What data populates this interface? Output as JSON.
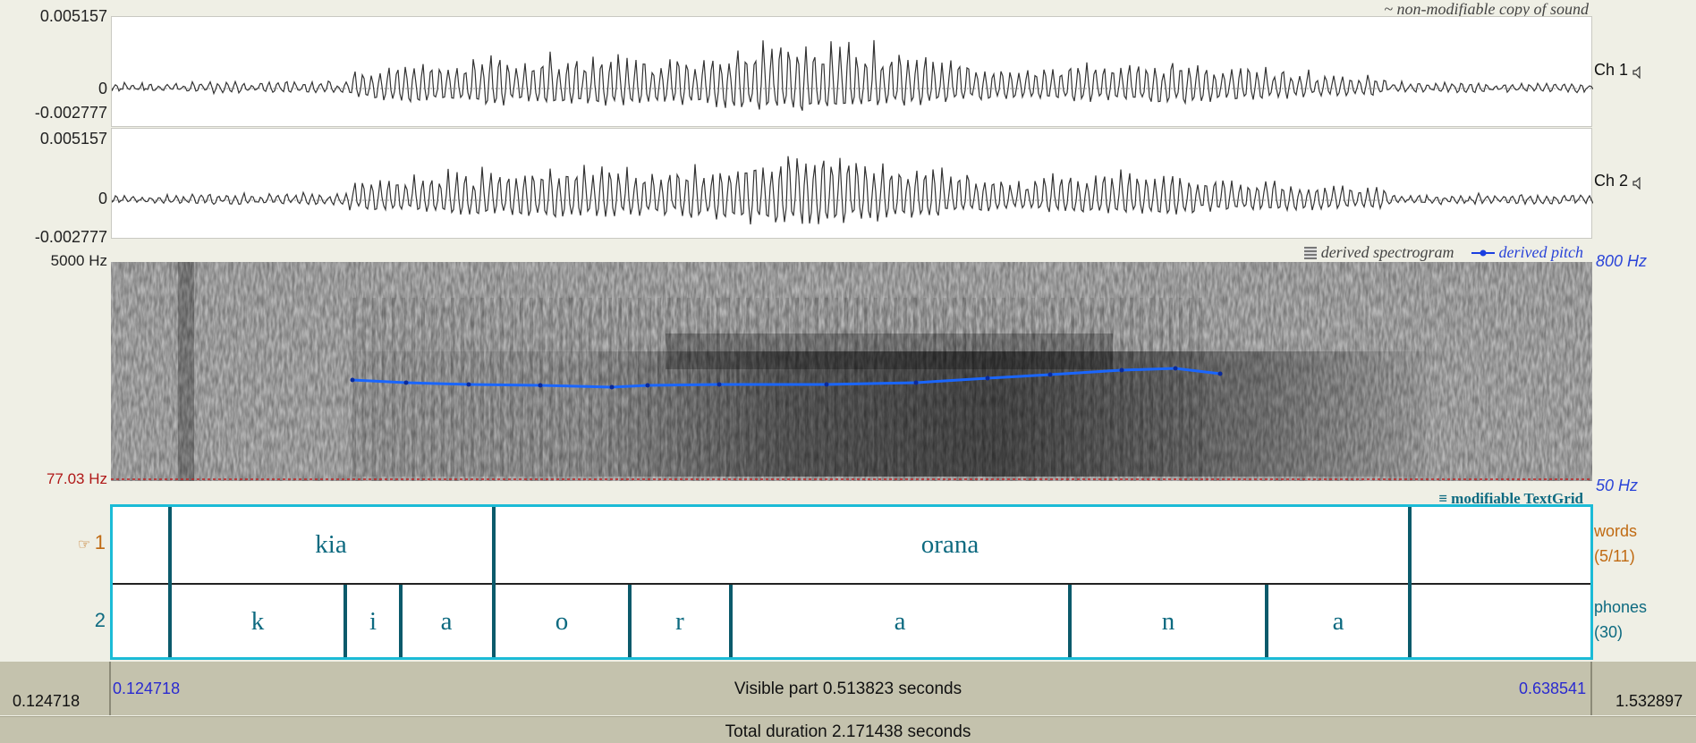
{
  "waveform": {
    "banner": "~ non-modifiable copy of sound",
    "ch1": {
      "max": "0.005157",
      "zero": "0",
      "min": "-0.002777",
      "label": "Ch 1"
    },
    "ch2": {
      "max": "0.005157",
      "zero": "0",
      "min": "-0.002777",
      "label": "Ch 2"
    }
  },
  "spectrogram": {
    "top_freq": "5000 Hz",
    "bottom_freq": "77.03 Hz",
    "legend_spectrogram": "derived spectrogram",
    "legend_pitch": "derived pitch",
    "pitch_top": "800 Hz",
    "pitch_bottom": "50 Hz"
  },
  "textgrid": {
    "banner": "modifiable TextGrid",
    "tier1": {
      "number": "1",
      "name": "words",
      "count": "(5/11)"
    },
    "tier2": {
      "number": "2",
      "name": "phones",
      "count": "(30)"
    },
    "words": [
      "kia",
      "orana"
    ],
    "phones": [
      "k",
      "i",
      "a",
      "o",
      "r",
      "a",
      "n",
      "a"
    ]
  },
  "time": {
    "visible_start": "0.124718",
    "visible_end": "0.638541",
    "visible_part": "Visible part 0.513823 seconds",
    "window_start": "0.124718",
    "window_end": "1.532897",
    "total_duration": "Total duration 2.171438 seconds"
  },
  "colors": {
    "textgrid_border": "#1bbbd6",
    "boundary": "#0b5a6b",
    "pitch": "#1a5be0",
    "tier1_label": "#c06a12",
    "tier2_label": "#0d6a80"
  }
}
